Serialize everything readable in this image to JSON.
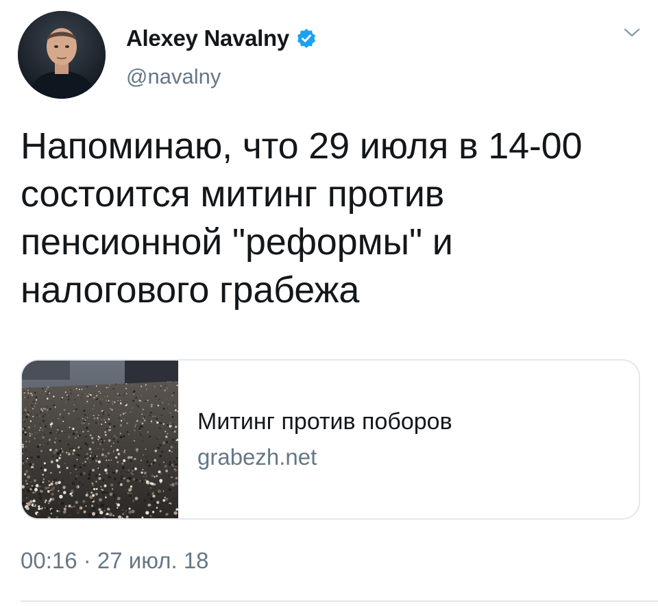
{
  "author": {
    "display_name": "Alexey Navalny",
    "handle": "@navalny",
    "verified": true,
    "avatar_icon": "profile-photo"
  },
  "tweet": {
    "text": "Напоминаю, что 29 июля в 14-00 состоится митинг против пенсионной \"реформы\" и налогового грабежа",
    "timestamp": "00:16 · 27 июл. 18"
  },
  "link_card": {
    "title": "Митинг против поборов",
    "domain": "grabezh.net",
    "image_icon": "crowd-photo"
  },
  "colors": {
    "primary_text": "#14171a",
    "secondary_text": "#657786",
    "verified_blue": "#1da1f2",
    "border": "#e1e8ed"
  },
  "icons": {
    "menu": "chevron-down-icon",
    "verified": "verified-badge-icon"
  }
}
